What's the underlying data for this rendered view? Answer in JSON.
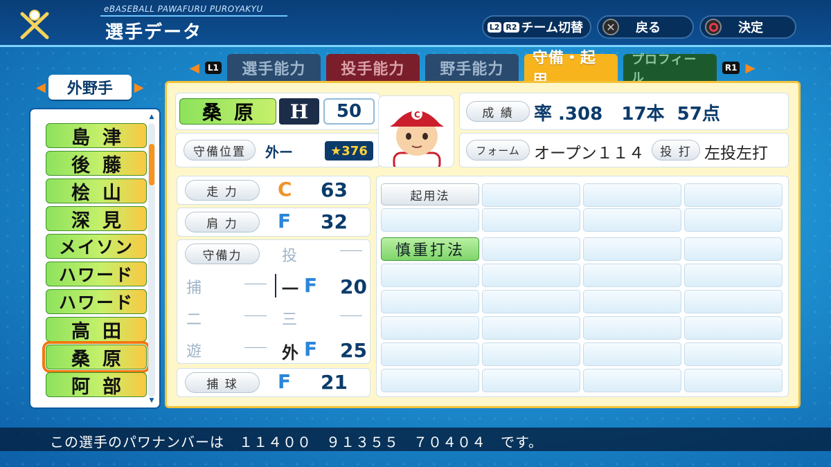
{
  "header": {
    "brand": "eBASEBALL PAWAFURU PUROYAKYU",
    "title": "選手データ",
    "buttons": {
      "l2": "L2",
      "r2": "R2",
      "team_switch": "チーム切替",
      "back": "戻る",
      "confirm": "決定"
    }
  },
  "tabs": {
    "l1": "L1",
    "r1": "R1",
    "items": [
      {
        "label": "選手能力"
      },
      {
        "label": "投手能力"
      },
      {
        "label": "野手能力"
      },
      {
        "label": "守備・起用"
      },
      {
        "label": "プロフィール"
      }
    ],
    "active_index": 3
  },
  "position_selector": {
    "label": "外野手"
  },
  "players": [
    {
      "name": "島津"
    },
    {
      "name": "後藤"
    },
    {
      "name": "桧山"
    },
    {
      "name": "深見"
    },
    {
      "name": "メイソン"
    },
    {
      "name": "ハワード"
    },
    {
      "name": "ハワード"
    },
    {
      "name": "高田"
    },
    {
      "name": "桑原"
    },
    {
      "name": "阿部"
    }
  ],
  "selected_player_index": 8,
  "player": {
    "name": "桑原",
    "team_logo": "H",
    "number": "50",
    "position_label": "守備位置",
    "position_value": "外ー",
    "star_value": "376"
  },
  "record": {
    "label": "成 績",
    "text": "率 .308   17本  57点"
  },
  "form": {
    "label": "フォーム",
    "value": "オープン１１４",
    "hand_label": "投 打",
    "hand_value": "左投左打"
  },
  "abilities": {
    "speed": {
      "label": "走 力",
      "rank": "C",
      "value": "63"
    },
    "arm": {
      "label": "肩 力",
      "rank": "F",
      "value": "32"
    },
    "fielding_label": "守備力",
    "fielding": {
      "p": {
        "pos": "投",
        "dash": "――"
      },
      "c": {
        "pos": "捕",
        "dash": "――"
      },
      "first": {
        "pos": "一",
        "rank": "F",
        "value": "20"
      },
      "second": {
        "pos": "二",
        "dash": "――"
      },
      "third": {
        "pos": "三",
        "dash": "――"
      },
      "ss": {
        "pos": "遊",
        "dash": "――"
      },
      "of": {
        "pos": "外",
        "rank": "F",
        "value": "25"
      }
    },
    "catching": {
      "label": "捕 球",
      "rank": "F",
      "value": "21"
    }
  },
  "usage": {
    "label": "起用法",
    "skills": [
      "慎重打法"
    ]
  },
  "footer": {
    "text": "この選手のパワナンバーは　１１４００　９１３５５　７０４０４　です。"
  },
  "colors": {
    "accent_orange": "#f07810",
    "rank_c": "#f0932b",
    "rank_f": "#2a86d9",
    "active_tab": "#f7b41d"
  }
}
